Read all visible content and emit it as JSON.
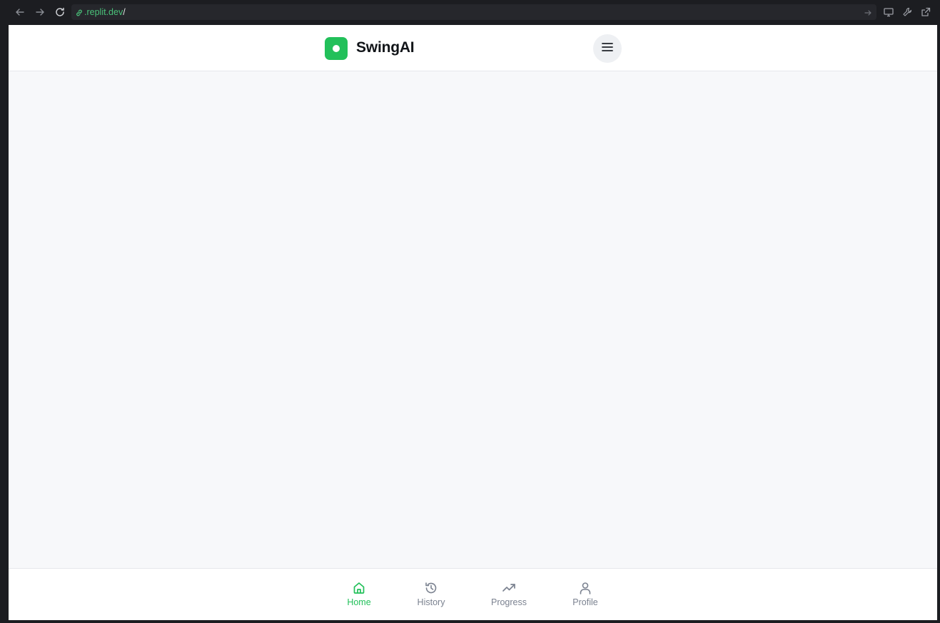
{
  "browser": {
    "url_domain": ".replit.dev",
    "url_path": "/"
  },
  "app": {
    "title": "SwingAI",
    "accent_color": "#22c05a",
    "menu_icon": "hamburger-menu-icon"
  },
  "bottom_nav": {
    "items": [
      {
        "label": "Home",
        "icon": "home-icon",
        "active": true
      },
      {
        "label": "History",
        "icon": "history-icon",
        "active": false
      },
      {
        "label": "Progress",
        "icon": "trending-up-icon",
        "active": false
      },
      {
        "label": "Profile",
        "icon": "user-icon",
        "active": false
      }
    ]
  }
}
